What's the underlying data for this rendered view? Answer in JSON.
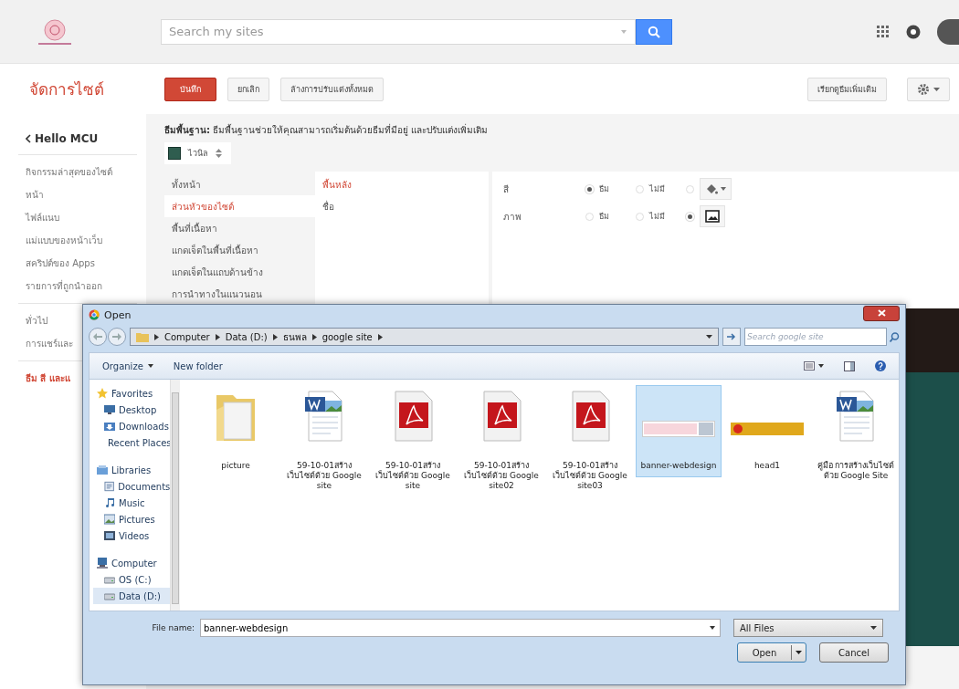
{
  "search": {
    "placeholder": "Search my sites"
  },
  "page_title": "จัดการไซต์",
  "actions": [
    {
      "label": "บันทึก",
      "kind": "primary"
    },
    {
      "label": "ยกเลิก",
      "kind": "plain"
    },
    {
      "label": "ล้างการปรับแต่งทั้งหมด",
      "kind": "plain"
    }
  ],
  "more_themes": "เรียกดูธีมเพิ่มเติม",
  "sidebar": {
    "back": "Hello MCU",
    "groups": [
      [
        {
          "label": "กิจกรรมล่าสุดของไซต์",
          "selected": false
        },
        {
          "label": "หน้า",
          "selected": false
        },
        {
          "label": "ไฟล์แนบ",
          "selected": false
        },
        {
          "label": "แม่แบบของหน้าเว็บ",
          "selected": false
        },
        {
          "label": "สคริปต์ของ Apps",
          "selected": false
        },
        {
          "label": "รายการที่ถูกนำออก",
          "selected": false
        }
      ],
      [
        {
          "label": "ทั่วไป",
          "selected": false
        },
        {
          "label": "การแชร์และ",
          "selected": false
        }
      ],
      [
        {
          "label": "ธีม สี และแ",
          "selected": true
        }
      ]
    ]
  },
  "theme": {
    "heading": "**ธีมพื้นฐาน:** ธีมพื้นฐานช่วยให้คุณสามารถเริ่มต้นด้วยธีมที่มีอยู่ และปรับแต่งเพิ่มเติม",
    "theme_name": "ไวนิล",
    "areas": [
      {
        "label": "ทั้งหน้า",
        "selected": false
      },
      {
        "label": "ส่วนหัวของไซต์",
        "selected": true
      },
      {
        "label": "พื้นที่เนื้อหา",
        "selected": false
      },
      {
        "label": "แกดเจ็ตในพื้นที่เนื้อหา",
        "selected": false
      },
      {
        "label": "แกดเจ็ตในแถบด้านข้าง",
        "selected": false
      },
      {
        "label": "การนำทางในแนวนอน",
        "selected": false
      }
    ],
    "elements": [
      {
        "label": "พื้นหลัง",
        "selected": true
      },
      {
        "label": "ชื่อ",
        "selected": false
      }
    ],
    "options": [
      {
        "label": "สี",
        "choices": [
          {
            "kind": "text",
            "label": "ธีม",
            "selected": true
          },
          {
            "kind": "text",
            "label": "ไม่มี",
            "selected": false
          },
          {
            "kind": "color",
            "selected": false
          }
        ]
      },
      {
        "label": "ภาพ",
        "choices": [
          {
            "kind": "text",
            "label": "ธีม",
            "selected": false
          },
          {
            "kind": "text",
            "label": "ไม่มี",
            "selected": false
          },
          {
            "kind": "image",
            "selected": true
          }
        ]
      }
    ]
  },
  "dialog": {
    "title": "Open",
    "path": [
      "Computer",
      "Data (D:)",
      "ธนพล",
      "google site"
    ],
    "search_placeholder": "Search google site",
    "toolbar": [
      {
        "label": "Organize",
        "dropdown": true
      },
      {
        "label": "New folder",
        "dropdown": false
      }
    ],
    "nav": [
      {
        "label": "Favorites",
        "selected": false,
        "children": [
          {
            "label": "Desktop",
            "selected": false
          },
          {
            "label": "Downloads",
            "selected": false
          },
          {
            "label": "Recent Places",
            "selected": false
          }
        ]
      },
      {
        "label": "Libraries",
        "selected": false,
        "children": [
          {
            "label": "Documents",
            "selected": false
          },
          {
            "label": "Music",
            "selected": false
          },
          {
            "label": "Pictures",
            "selected": false
          },
          {
            "label": "Videos",
            "selected": false
          }
        ]
      },
      {
        "label": "Computer",
        "selected": false,
        "children": [
          {
            "label": "OS (C:)",
            "selected": false
          },
          {
            "label": "Data (D:)",
            "selected": true
          }
        ]
      }
    ],
    "files": [
      {
        "name": "picture",
        "kind": "folder",
        "selected": false
      },
      {
        "name": "59-10-01สร้างเว็บไซต์ด้วย Google site",
        "kind": "word",
        "selected": false
      },
      {
        "name": "59-10-01สร้างเว็บไซต์ด้วย Google site",
        "kind": "pdf",
        "selected": false
      },
      {
        "name": "59-10-01สร้างเว็บไซต์ด้วย Google site02",
        "kind": "pdf",
        "selected": false
      },
      {
        "name": "59-10-01สร้างเว็บไซต์ด้วย Google site03",
        "kind": "pdf",
        "selected": false
      },
      {
        "name": "banner-webdesign",
        "kind": "banner",
        "selected": true
      },
      {
        "name": "head1",
        "kind": "strip",
        "selected": false
      },
      {
        "name": "คู่มือ การสร้างเว็บไซต์ด้วย Google Site",
        "kind": "word",
        "selected": false
      }
    ],
    "file_name_label": "File name:",
    "file_name": "banner-webdesign",
    "filter": "All Files",
    "buttons": [
      {
        "label": "Open",
        "kind": "split"
      },
      {
        "label": "Cancel",
        "kind": "plain"
      }
    ]
  }
}
